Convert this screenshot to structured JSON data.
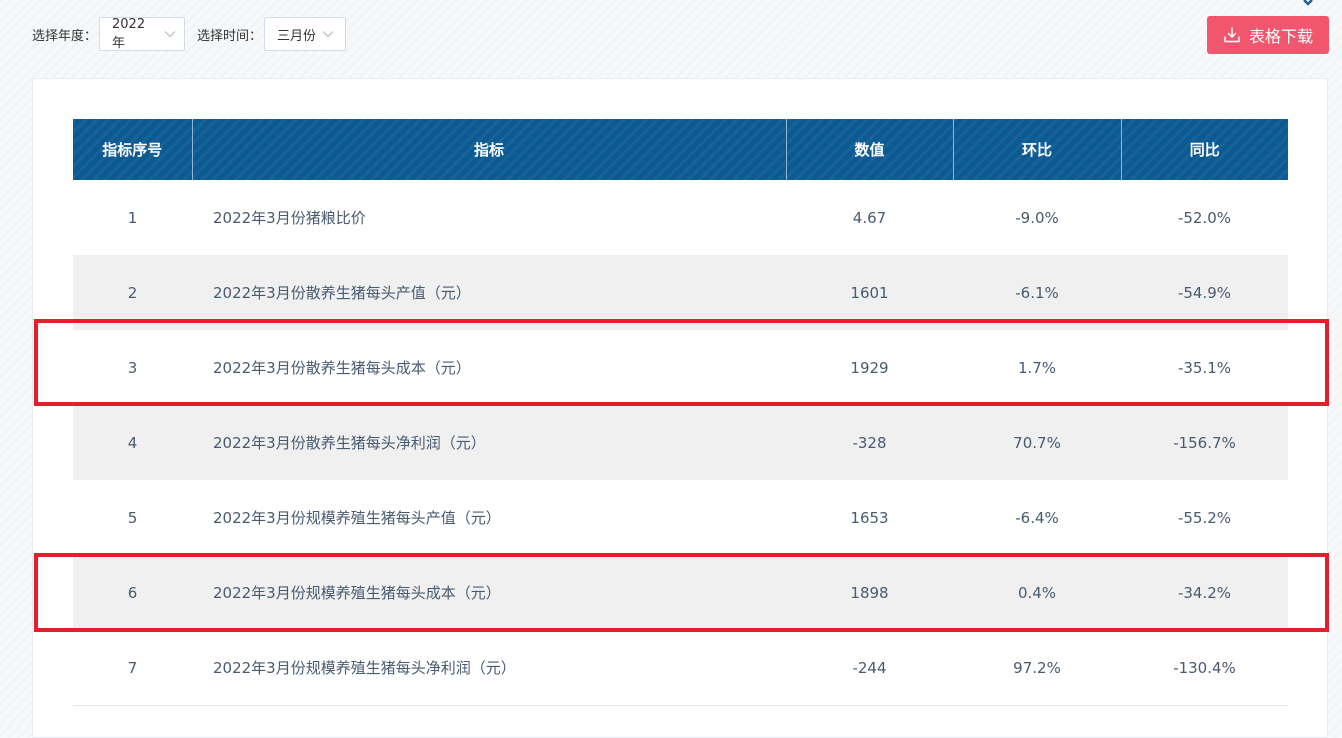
{
  "filters": {
    "year_label": "选择年度：",
    "year_value": "2022年",
    "month_label": "选择时间：",
    "month_value": "三月份"
  },
  "download_button": {
    "label": "表格下载"
  },
  "table": {
    "headers": [
      "指标序号",
      "指标",
      "数值",
      "环比",
      "同比"
    ],
    "rows": [
      {
        "index": "1",
        "name": "2022年3月份猪粮比价",
        "value": "4.67",
        "mom": "-9.0%",
        "yoy": "-52.0%"
      },
      {
        "index": "2",
        "name": "2022年3月份散养生猪每头产值（元）",
        "value": "1601",
        "mom": "-6.1%",
        "yoy": "-54.9%"
      },
      {
        "index": "3",
        "name": "2022年3月份散养生猪每头成本（元）",
        "value": "1929",
        "mom": "1.7%",
        "yoy": "-35.1%"
      },
      {
        "index": "4",
        "name": "2022年3月份散养生猪每头净利润（元）",
        "value": "-328",
        "mom": "70.7%",
        "yoy": "-156.7%"
      },
      {
        "index": "5",
        "name": "2022年3月份规模养殖生猪每头产值（元）",
        "value": "1653",
        "mom": "-6.4%",
        "yoy": "-55.2%"
      },
      {
        "index": "6",
        "name": "2022年3月份规模养殖生猪每头成本（元）",
        "value": "1898",
        "mom": "0.4%",
        "yoy": "-34.2%"
      },
      {
        "index": "7",
        "name": "2022年3月份规模养殖生猪每头净利润（元）",
        "value": "-244",
        "mom": "97.2%",
        "yoy": "-130.4%"
      }
    ]
  },
  "colors": {
    "header_bg": "#0c5a92",
    "button_bg": "#f2566e",
    "highlight": "#e0202a",
    "stripe": "#f0f0f0"
  }
}
